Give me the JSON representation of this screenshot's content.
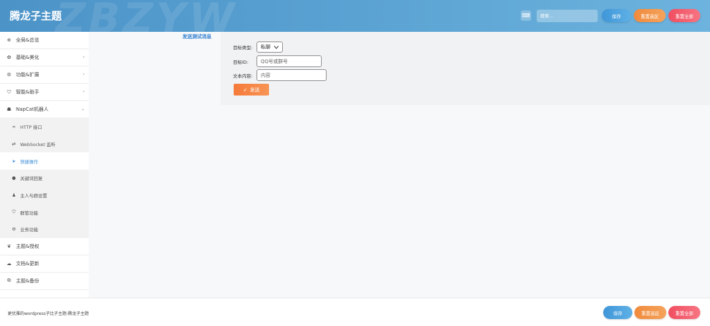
{
  "header": {
    "watermark": "ZBZYW",
    "title": "腾龙子主题",
    "kbd_icon": "keyboard-icon",
    "search_placeholder": "搜索...",
    "save_label": "保存",
    "reset_section_label": "重置选区",
    "reset_all_label": "重置全部"
  },
  "sidebar": {
    "items": [
      {
        "label": "全局&总览",
        "icon": "globe-icon",
        "chevron": ""
      },
      {
        "label": "基础&美化",
        "icon": "gear-icon",
        "chevron": "›"
      },
      {
        "label": "功能&扩展",
        "icon": "cubes-icon",
        "chevron": "›"
      },
      {
        "label": "智能&助手",
        "icon": "shield-icon",
        "chevron": "›"
      },
      {
        "label": "NapCat机器人",
        "icon": "bot-icon",
        "chevron": "⌄"
      }
    ],
    "subitems": [
      {
        "label": "HTTP 接口",
        "icon": "link-icon"
      },
      {
        "label": "WebSocket 监听",
        "icon": "swap-icon"
      },
      {
        "label": "快捷操作",
        "icon": "send-icon",
        "active": true
      },
      {
        "label": "关键词回复",
        "icon": "comment-icon"
      },
      {
        "label": "主人与群设置",
        "icon": "user-icon"
      },
      {
        "label": "群管功能",
        "icon": "shield-icon"
      },
      {
        "label": "业务功能",
        "icon": "gears-icon"
      }
    ],
    "bottom_items": [
      {
        "label": "主题&授权",
        "icon": "laurel-icon"
      },
      {
        "label": "文档&更新",
        "icon": "cloud-icon"
      },
      {
        "label": "主题&备份",
        "icon": "copy-icon"
      }
    ]
  },
  "main": {
    "panel_label": "发送测试消息",
    "form": {
      "type_label": "目标类型:",
      "type_value": "私聊",
      "id_label": "目标ID:",
      "id_placeholder": "QQ号或群号",
      "text_label": "文本内容:",
      "text_placeholder": "内容",
      "send_label": "发送"
    }
  },
  "footer": {
    "text": "更优雅的wordpress子比子主题-腾龙子主题",
    "save_label": "保存",
    "reset_section_label": "重置选区",
    "reset_all_label": "重置全部"
  }
}
